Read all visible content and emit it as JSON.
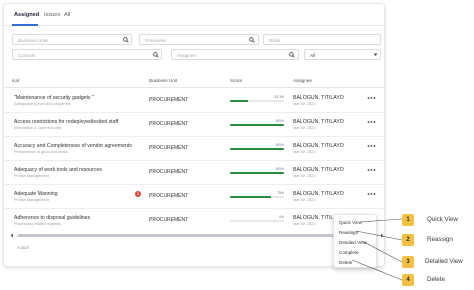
{
  "tabs": [
    {
      "label": "Assigned",
      "active": true
    },
    {
      "label": "Issues",
      "active": false
    },
    {
      "label": "All",
      "active": false
    }
  ],
  "filters": {
    "business_units_placeholder": "Business Units",
    "processes_placeholder": "Processes",
    "risks_placeholder": "Risks",
    "controls_placeholder": "Controls",
    "assignee_placeholder": "Assignee",
    "status_value": "All"
  },
  "table": {
    "columns": {
      "name": "ical",
      "business_unit": "Business Unit",
      "score": "Score",
      "assignee": "Assignee"
    },
    "rows": [
      {
        "title": "\"Maintenance of security gadgets \"",
        "subtitle": "Safeguarding lives and properties",
        "unit": "PROCUREMENT",
        "score": "33.3%",
        "score_value": 33.3,
        "assignee": "BALOGUN, TITILAYO",
        "date": "Mar 30, 2022",
        "badge": ""
      },
      {
        "title": "Access restrictions for redeployed/exited staff",
        "subtitle": "Information & Cybersecurity",
        "unit": "PROCUREMENT",
        "score": "100%",
        "score_value": 100,
        "assignee": "BALOGUN, TITILAYO",
        "date": "Mar 30, 2022",
        "badge": ""
      },
      {
        "title": "Accuracy and Completeness of vendor agreements",
        "subtitle": "Performance of good and works",
        "unit": "PROCUREMENT",
        "score": "100%",
        "score_value": 100,
        "assignee": "BALOGUN, TITILAYO",
        "date": "Mar 30, 2022",
        "badge": ""
      },
      {
        "title": "Adequacy of work tools and resources",
        "subtitle": "People Management",
        "unit": "PROCUREMENT",
        "score": "100%",
        "score_value": 100,
        "assignee": "BALOGUN, TITILAYO",
        "date": "Mar 30, 2022",
        "badge": ""
      },
      {
        "title": "Adequate Manning",
        "subtitle": "People Management",
        "unit": "PROCUREMENT",
        "score": "75%",
        "score_value": 75,
        "assignee": "BALOGUN, TITILAYO",
        "date": "Mar 30, 2022",
        "badge": "1"
      },
      {
        "title": "Adherence to disposal guidelines",
        "subtitle": "Processing related requests",
        "unit": "PROCUREMENT",
        "score": "0%",
        "score_value": 0,
        "assignee": "BALOGUN, TITILAYO",
        "date": "Mar 30, 2022",
        "badge": ""
      }
    ],
    "footer": "Actual"
  },
  "context_menu": {
    "items": [
      "Quick View",
      "Reassign",
      "Detailed View",
      "Complete",
      "Delete"
    ]
  },
  "callouts": [
    {
      "number": "1",
      "label": "Quick View"
    },
    {
      "number": "2",
      "label": "Reassign"
    },
    {
      "number": "3",
      "label": "Detailed View"
    },
    {
      "number": "4",
      "label": "Delete"
    }
  ],
  "colors": {
    "accent": "#2f6fd6",
    "score_bar": "#2a8a3e",
    "badge": "#e0413f",
    "callout": "#f3c043"
  }
}
